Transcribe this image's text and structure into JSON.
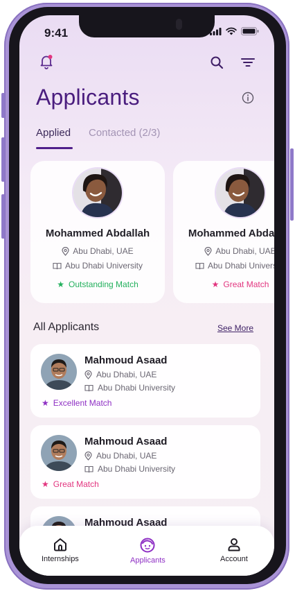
{
  "status": {
    "time": "9:41"
  },
  "header": {
    "title": "Applicants"
  },
  "tabs": [
    {
      "label": "Applied",
      "active": true
    },
    {
      "label": "Contacted (2/3)",
      "active": false
    }
  ],
  "featured": [
    {
      "name": "Mohammed Abdallah",
      "location": "Abu Dhabi, UAE",
      "university": "Abu Dhabi University",
      "match": "Outstanding Match",
      "match_color": "#22b05c"
    },
    {
      "name": "Mohammed Abdallah",
      "location": "Abu Dhabi, UAE",
      "university": "Abu Dhabi University",
      "match": "Great Match",
      "match_color": "#e2357f"
    }
  ],
  "all_applicants": {
    "title": "All Applicants",
    "see_more": "See More",
    "items": [
      {
        "name": "Mahmoud Asaad",
        "location": "Abu Dhabi, UAE",
        "university": "Abu Dhabi University",
        "match": "Excellent Match",
        "match_color": "#8e2fc4"
      },
      {
        "name": "Mahmoud Asaad",
        "location": "Abu Dhabi, UAE",
        "university": "Abu Dhabi University",
        "match": "Great Match",
        "match_color": "#e2357f"
      },
      {
        "name": "Mahmoud Asaad",
        "location": "",
        "university": "",
        "match": "",
        "match_color": "#8e2fc4"
      }
    ]
  },
  "nav": [
    {
      "label": "Internships",
      "icon": "home-icon",
      "active": false
    },
    {
      "label": "Applicants",
      "icon": "applicants-face-icon",
      "active": true
    },
    {
      "label": "Account",
      "icon": "person-icon",
      "active": false
    }
  ],
  "colors": {
    "accent": "#4a1d7e",
    "active_nav": "#8e2fc4",
    "notification_dot": "#e2357f"
  }
}
